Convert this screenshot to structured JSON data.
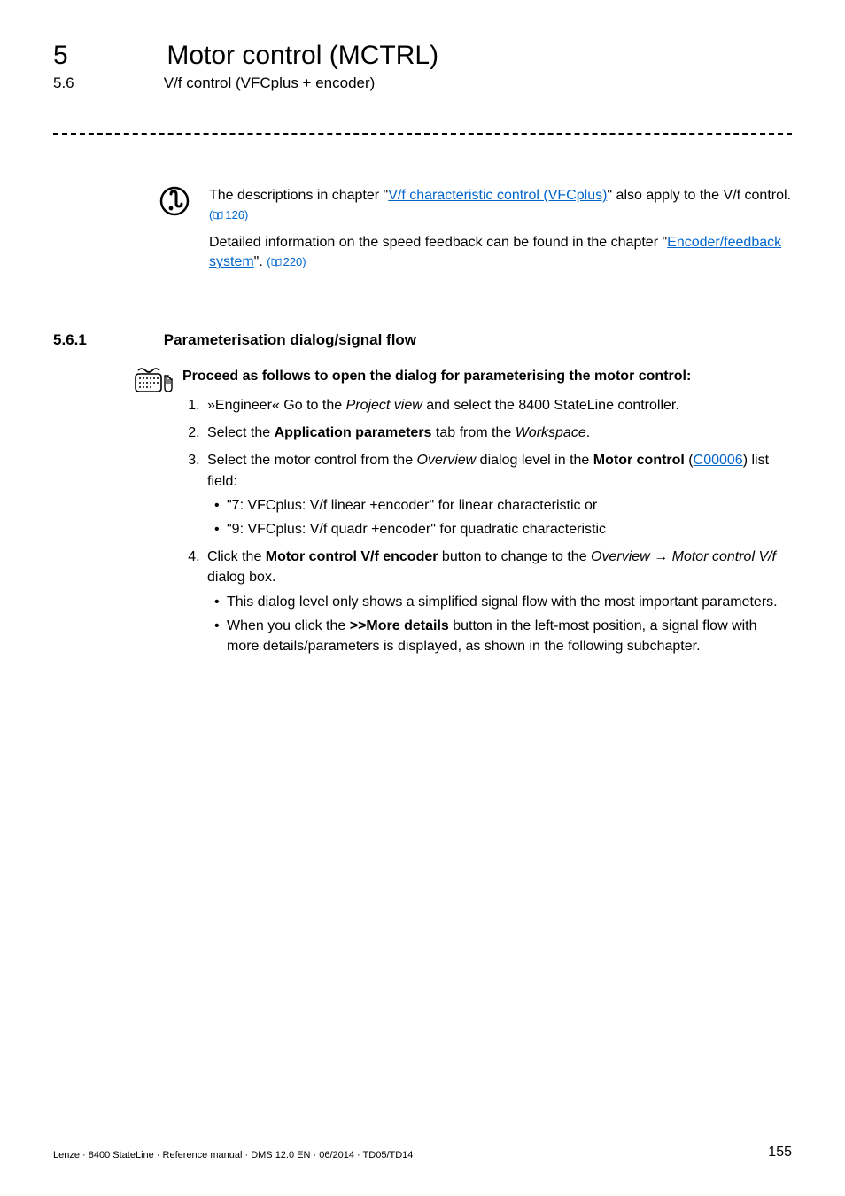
{
  "header": {
    "chapter_number": "5",
    "chapter_title": "Motor control (MCTRL)",
    "section_number": "5.6",
    "section_title": "V/f control (VFCplus + encoder)"
  },
  "info": {
    "para1_pre": "The descriptions in chapter \"",
    "para1_link": "V/f characteristic control (VFCplus)",
    "para1_post": "\" also apply to the V/f control. ",
    "para1_ref": "126",
    "para2_pre": "Detailed information on the speed feedback can be found in the chapter \"",
    "para2_link": "Encoder/feedback system",
    "para2_post": "\". ",
    "para2_ref": "220"
  },
  "subsection": {
    "number": "5.6.1",
    "title": "Parameterisation dialog/signal flow"
  },
  "instructions": {
    "lead": "Proceed as follows to open the dialog for parameterising the motor control:",
    "steps": [
      {
        "parts": [
          {
            "t": " »Engineer« Go to the "
          },
          {
            "t": "Project view",
            "i": true
          },
          {
            "t": " and select the 8400 StateLine controller."
          }
        ]
      },
      {
        "parts": [
          {
            "t": "Select the "
          },
          {
            "t": "Application parameters",
            "b": true
          },
          {
            "t": " tab from the "
          },
          {
            "t": "Workspace",
            "i": true
          },
          {
            "t": "."
          }
        ]
      },
      {
        "parts": [
          {
            "t": "Select the motor control from the "
          },
          {
            "t": "Overview",
            "i": true
          },
          {
            "t": " dialog level in the "
          },
          {
            "t": "Motor control",
            "b": true
          },
          {
            "t": " ("
          },
          {
            "t": "C00006",
            "link": true
          },
          {
            "t": ") list field:"
          }
        ],
        "bullets": [
          "\"7: VFCplus: V/f linear +encoder\" for linear characteristic or",
          "\"9: VFCplus: V/f quadr +encoder\" for quadratic characteristic"
        ]
      },
      {
        "parts": [
          {
            "t": "Click the "
          },
          {
            "t": "Motor control V/f encoder",
            "b": true
          },
          {
            "t": " button to change to the "
          },
          {
            "t": "Overview ",
            "i": true
          },
          {
            "t": "→ ",
            "arrow": true
          },
          {
            "t": "Motor control V/f",
            "i": true
          },
          {
            "t": " dialog box."
          }
        ],
        "bullets2": [
          {
            "parts": [
              {
                "t": "This dialog level only shows a simplified signal flow with the most important parameters."
              }
            ]
          },
          {
            "parts": [
              {
                "t": "When you click the "
              },
              {
                "t": ">>More details",
                "b": true
              },
              {
                "t": " button in the left-most position, a signal flow with more details/parameters is displayed, as shown in the following subchapter."
              }
            ]
          }
        ]
      }
    ]
  },
  "footer": {
    "left": "Lenze · 8400 StateLine · Reference manual · DMS 12.0 EN · 06/2014 · TD05/TD14",
    "page": "155"
  }
}
